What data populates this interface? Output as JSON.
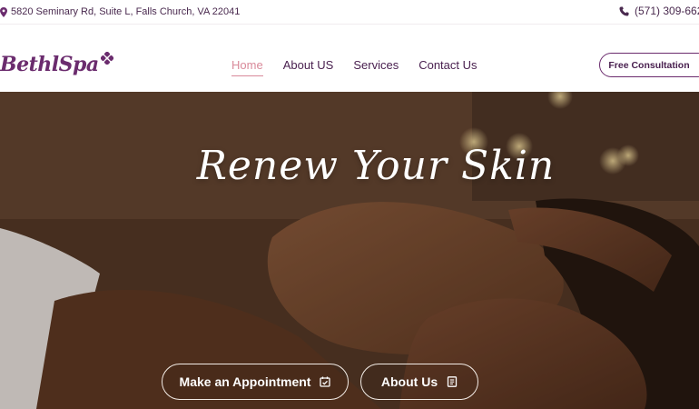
{
  "topbar": {
    "address": "5820 Seminary Rd, Suite L, Falls Church, VA 22041",
    "phone": "(571) 309-662"
  },
  "header": {
    "logo_text": "BethlSpa",
    "nav": [
      {
        "label": "Home",
        "active": true
      },
      {
        "label": "About US",
        "active": false
      },
      {
        "label": "Services",
        "active": false
      },
      {
        "label": "Contact Us",
        "active": false
      }
    ],
    "cta_label": "Free Consultation"
  },
  "hero": {
    "title": "Renew Your Skin",
    "buttons": {
      "appointment": "Make an Appointment",
      "about": "About Us"
    }
  },
  "colors": {
    "brand_purple": "#6b2c6e",
    "nav_active": "#d98a9a",
    "nav_text": "#4a2150"
  },
  "icons": [
    "map-pin-icon",
    "phone-icon",
    "flower-logo-icon",
    "calendar-check-icon",
    "document-icon"
  ]
}
